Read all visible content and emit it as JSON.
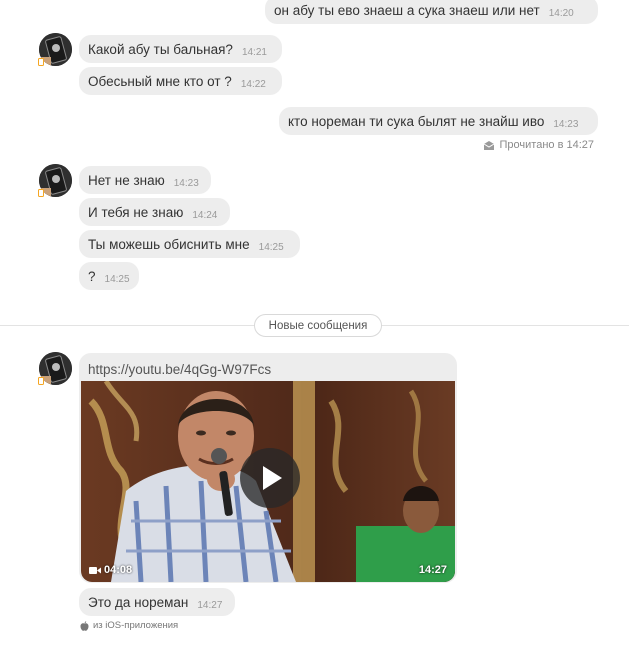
{
  "messages": {
    "m1": {
      "text": "он абу ты ево знаеш а сука знаеш или нет",
      "time": "14:20"
    },
    "m2": {
      "text": "Какой абу ты бальная?",
      "time": "14:21"
    },
    "m3": {
      "text": "Обесьный мне кто от ?",
      "time": "14:22"
    },
    "m4": {
      "text": "кто нореман ти сука былят не знайш иво",
      "time": "14:23"
    },
    "m5": {
      "text": "Нет не знаю",
      "time": "14:23"
    },
    "m6": {
      "text": "И тебя не знаю",
      "time": "14:24"
    },
    "m7": {
      "text": "Ты можешь обиснить мне",
      "time": "14:25"
    },
    "m8": {
      "text": "?",
      "time": "14:25"
    },
    "m9": {
      "text": "Это да нореман",
      "time": "14:27"
    }
  },
  "read_receipt": {
    "text": "Прочитано в 14:27",
    "icon": "envelope-open-icon"
  },
  "divider": {
    "label": "Новые сообщения"
  },
  "link_card": {
    "url": "https://youtu.be/4qGg-W97Fcs",
    "duration": "04:08",
    "time": "14:27",
    "play_icon": "play-icon",
    "camera_icon": "video-camera-icon"
  },
  "ios_note": {
    "text": "из iOS-приложения",
    "icon": "apple-icon"
  },
  "colors": {
    "bubble_bg": "#ededed",
    "online_indicator": "#f5a623",
    "divider": "#e3e3e3"
  }
}
